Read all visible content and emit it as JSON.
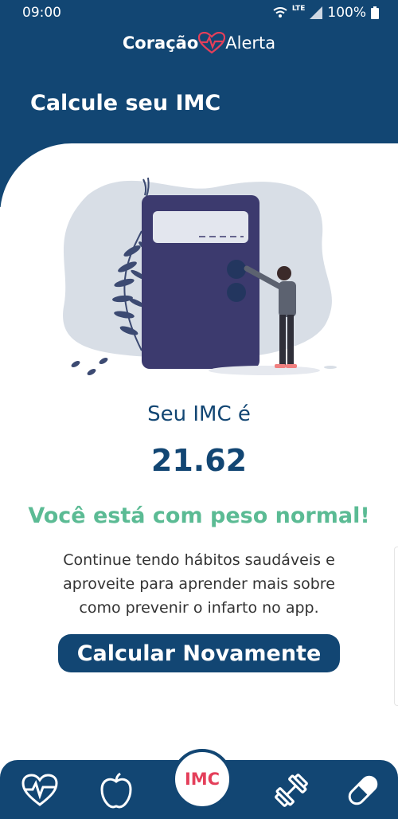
{
  "status_bar": {
    "time": "09:00",
    "network": "LTE",
    "battery": "100%"
  },
  "brand": {
    "part1": "Coração",
    "part2": "Alerta"
  },
  "header": {
    "title": "Calcule seu IMC"
  },
  "result": {
    "label": "Seu IMC é",
    "value": "21.62",
    "status": "Você está com peso normal!",
    "description": "Continue tendo hábitos saudáveis e aproveite para aprender mais sobre como prevenir o infarto no app."
  },
  "recalc_button": {
    "label": "Calcular Novamente"
  },
  "bottom_nav": {
    "items": [
      {
        "icon": "heart-pulse-icon"
      },
      {
        "icon": "apple-icon"
      },
      {
        "icon": "imc-tab",
        "label": "IMC"
      },
      {
        "icon": "dumbbell-icon"
      },
      {
        "icon": "pill-icon"
      }
    ]
  },
  "colors": {
    "primary": "#124673",
    "success": "#5bbb94",
    "accent": "#e43f5a"
  }
}
